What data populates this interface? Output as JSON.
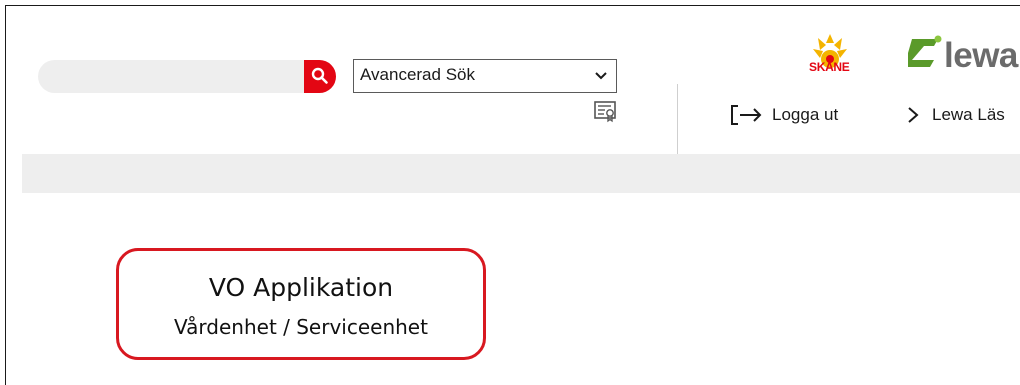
{
  "search": {
    "value": "",
    "placeholder": ""
  },
  "advanced_search": {
    "selected": "Avancerad Sök"
  },
  "icons": {
    "search": "search-icon",
    "chevron": "chevron-down-icon",
    "certificate": "certificate-icon",
    "logout": "logout-arrow-icon",
    "chevron_right": "chevron-right-icon"
  },
  "header": {
    "skane_logo_text": "SKÅNE",
    "lewa_logo_text": "lewa",
    "logout_label": "Logga ut",
    "lewa_las_label": "Lewa Läs"
  },
  "app_card": {
    "title": "VO Applikation",
    "subtitle": "Vårdenhet / Serviceenhet"
  },
  "colors": {
    "accent_red": "#e30613",
    "card_border": "#d81820",
    "band_grey": "#eeeeee",
    "lewa_green": "#5a9a2a"
  }
}
